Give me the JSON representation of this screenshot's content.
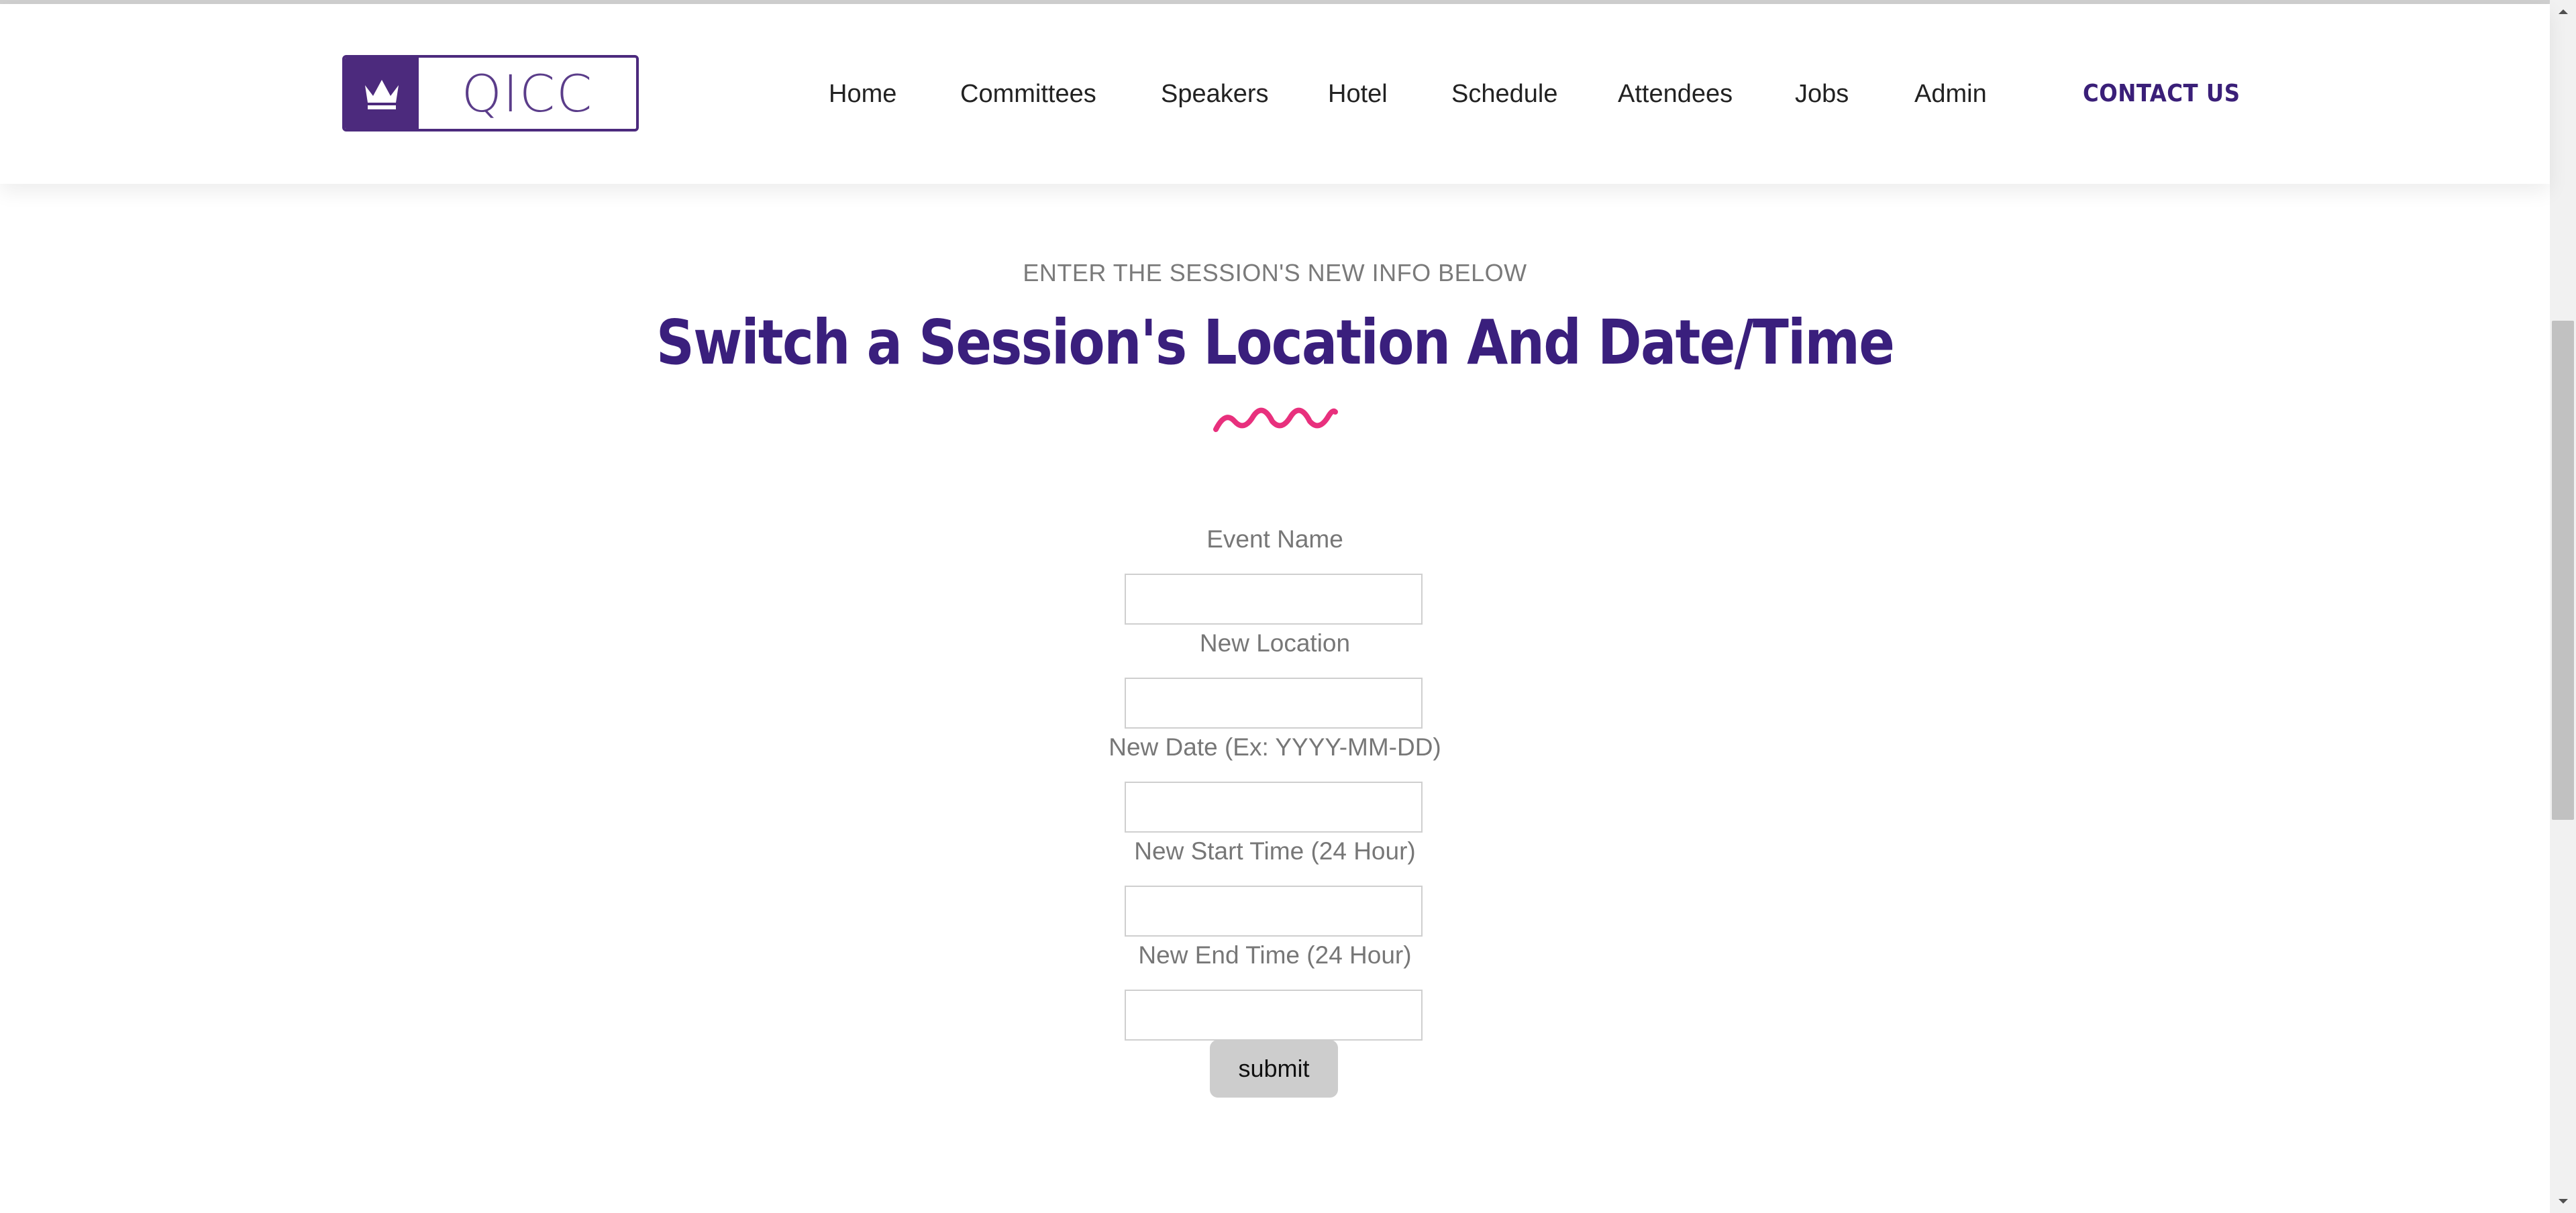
{
  "header": {
    "logo_text": "QICC",
    "logo_icon": "crown-icon",
    "nav": [
      {
        "label": "Home"
      },
      {
        "label": "Committees"
      },
      {
        "label": "Speakers"
      },
      {
        "label": "Hotel"
      },
      {
        "label": "Schedule"
      },
      {
        "label": "Attendees"
      },
      {
        "label": "Jobs"
      },
      {
        "label": "Admin"
      }
    ],
    "contact_label": "CONTACT US"
  },
  "hero": {
    "eyebrow": "ENTER THE SESSION'S NEW INFO BELOW",
    "title": "Switch a Session's Location And Date/Time",
    "divider_icon": "squiggle-divider"
  },
  "form": {
    "fields": [
      {
        "label": "Event Name",
        "value": ""
      },
      {
        "label": "New Location",
        "value": ""
      },
      {
        "label": "New Date (Ex: YYYY-MM-DD)",
        "value": ""
      },
      {
        "label": "New Start Time (24 Hour)",
        "value": ""
      },
      {
        "label": "New End Time (24 Hour)",
        "value": ""
      }
    ],
    "submit_label": "submit"
  },
  "colors": {
    "brand_purple": "#3a1f7d",
    "logo_purple": "#4c2a7d",
    "accent_pink": "#e8307d",
    "label_gray": "#777777",
    "button_gray": "#cdcdcd"
  }
}
